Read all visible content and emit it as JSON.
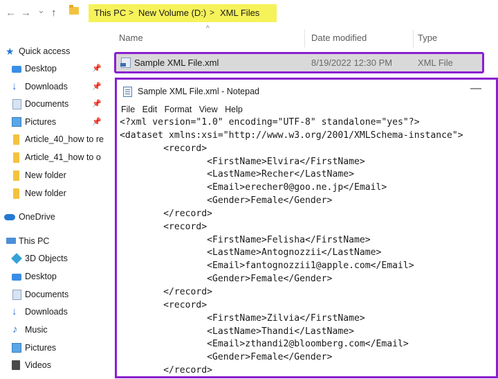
{
  "address_bar": {
    "back_icon": "←",
    "forward_icon": "→",
    "dropdown_icon": "⌄",
    "up_icon": "↑",
    "separator": ">",
    "path": [
      "This PC",
      "New Volume (D:)",
      "XML Files"
    ]
  },
  "sidebar": {
    "quick_access": "Quick access",
    "desktop": "Desktop",
    "downloads": "Downloads",
    "documents": "Documents",
    "pictures": "Pictures",
    "article40": "Article_40_how to re",
    "article41": "Article_41_how to o",
    "new_folder_1": "New folder",
    "new_folder_2": "New folder",
    "onedrive": "OneDrive",
    "this_pc": "This PC",
    "objects_3d": "3D Objects",
    "pc_desktop": "Desktop",
    "pc_documents": "Documents",
    "pc_downloads": "Downloads",
    "music": "Music",
    "pc_pictures": "Pictures",
    "videos": "Videos"
  },
  "file_list": {
    "columns": {
      "name": "Name",
      "date_modified": "Date modified",
      "type": "Type"
    },
    "files": [
      {
        "name": "Sample XML File.xml",
        "date_modified": "8/19/2022 12:30 PM",
        "type": "XML File"
      }
    ]
  },
  "notepad": {
    "title": "Sample XML File.xml - Notepad",
    "minimize": "—",
    "menu": {
      "file": "File",
      "edit": "Edit",
      "format": "Format",
      "view": "View",
      "help": "Help"
    },
    "content": "<?xml version=\"1.0\" encoding=\"UTF-8\" standalone=\"yes\"?>\n<dataset xmlns:xsi=\"http://www.w3.org/2001/XMLSchema-instance\">\n        <record>\n                <FirstName>Elvira</FirstName>\n                <LastName>Recher</LastName>\n                <Email>erecher0@goo.ne.jp</Email>\n                <Gender>Female</Gender>\n        </record>\n        <record>\n                <FirstName>Felisha</FirstName>\n                <LastName>Antognozzii</LastName>\n                <Email>fantognozzii1@apple.com</Email>\n                <Gender>Female</Gender>\n        </record>\n        <record>\n                <FirstName>Zilvia</FirstName>\n                <LastName>Thandi</LastName>\n                <Email>zthandi2@bloomberg.com</Email>\n                <Gender>Female</Gender>\n        </record>"
  },
  "colors": {
    "highlight_border": "#8a1fcf",
    "breadcrumb_highlight": "#f6f25a",
    "selected_row": "#d9d9d9"
  }
}
